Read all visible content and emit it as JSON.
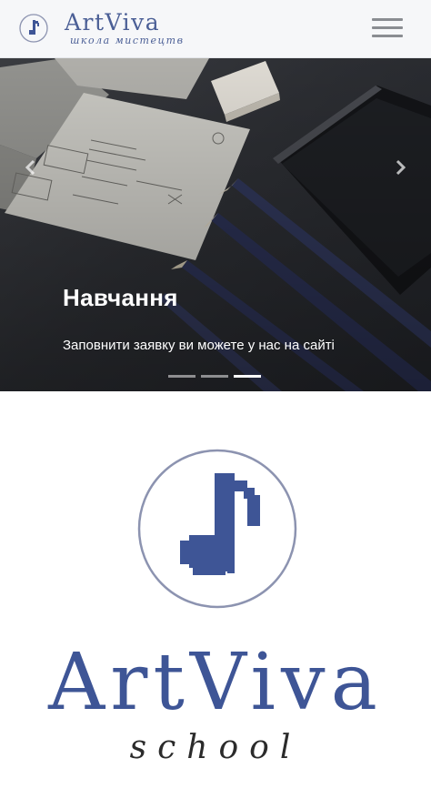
{
  "header": {
    "brand_name": "ArtViva",
    "brand_tagline": "школа мистецтв",
    "logo_icon": "music-note-icon",
    "menu_icon": "hamburger-icon"
  },
  "hero": {
    "slide_title": "Навчання",
    "slide_caption": "Заповнити заявку ви можете у нас на сайті",
    "prev_icon": "chevron-left-icon",
    "next_icon": "chevron-right-icon",
    "slide_count": 3,
    "active_slide": 3
  },
  "main_logo": {
    "icon": "music-note-icon",
    "name": "ArtViva",
    "subtitle": "school"
  },
  "colors": {
    "brand_blue": "#3e5596",
    "header_bg": "#f6f7f9",
    "circle_outline": "#8c93b0"
  }
}
